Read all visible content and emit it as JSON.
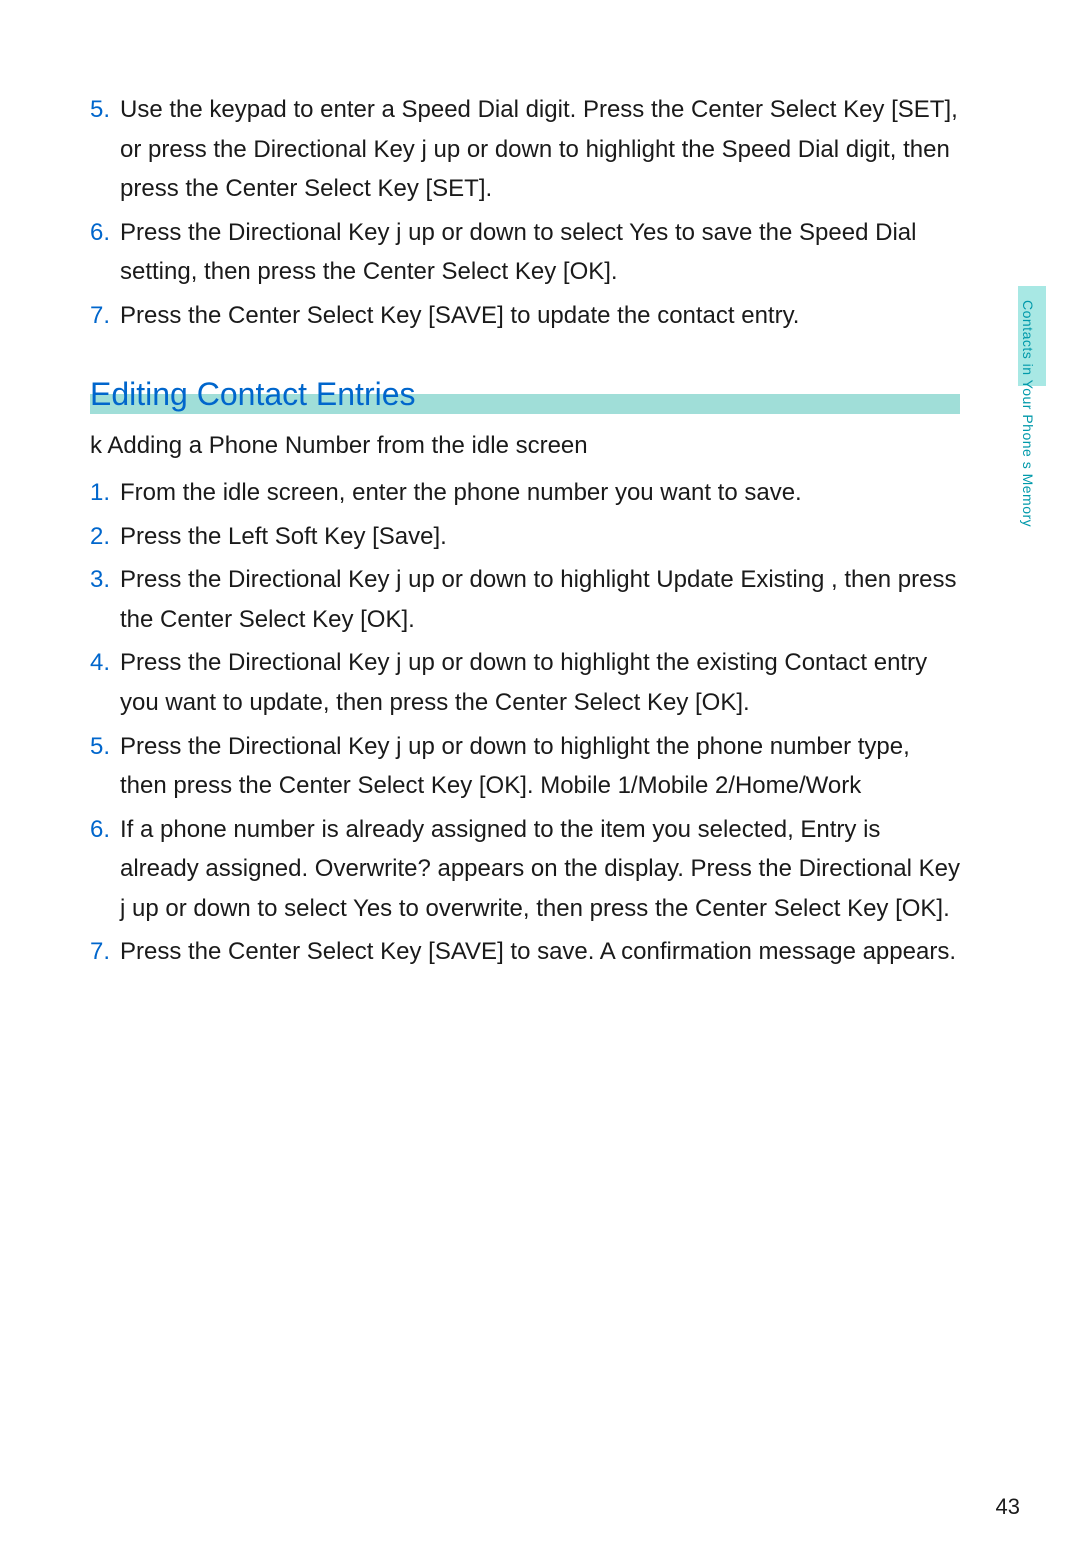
{
  "top_list": {
    "items": [
      {
        "num": "5.",
        "text": "Use the keypad to enter a Speed Dial digit. Press the Center Select Key [SET], or press the Directional Key j    up or down to highlight the Speed Dial digit, then press the Center Select Key [SET]."
      },
      {
        "num": "6.",
        "text": "Press the Directional Key j    up or down to select  Yes to save the Speed Dial setting, then press the Center Select Key  [OK]."
      },
      {
        "num": "7.",
        "text": "Press the Center Select Key [SAVE]  to update the contact entry."
      }
    ]
  },
  "section_heading": "Editing Contact Entries",
  "subheading": "k   Adding a Phone Number from the idle screen",
  "bottom_list": {
    "items": [
      {
        "num": "1.",
        "text": "From the idle screen, enter the phone number you want to save."
      },
      {
        "num": "2.",
        "text": "Press the Left Soft Key [Save]."
      },
      {
        "num": "3.",
        "text": "Press the Directional Key j    up or down to highlight  Update Existing  , then press the Center Select Key [OK]."
      },
      {
        "num": "4.",
        "text": "Press the Directional Key j    up or down to highlight the existing Contact entry you want to update, then press the Center Select Key [OK]."
      },
      {
        "num": "5.",
        "text": "Press the Directional Key j    up or down to highlight the phone number type, then press the Center Select Key  [OK]. Mobile 1/Mobile 2/Home/Work"
      },
      {
        "num": "6.",
        "text": "If a phone number is already assigned to the item you selected,  Entry is already assigned. Overwrite?    appears on the display. Press the Directional Key j    up or down to select  Yes  to overwrite, then press the Center Select Key [OK]."
      },
      {
        "num": "7.",
        "text": "Press the Center Select Key [SAVE]  to save. A confirmation message appears."
      }
    ]
  },
  "side_tab": "Contacts in Your Phone s Memory",
  "page_number": "43"
}
